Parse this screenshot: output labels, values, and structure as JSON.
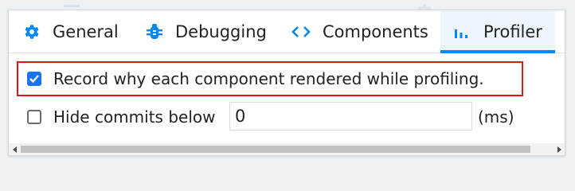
{
  "tabs": [
    {
      "label": "General",
      "icon": "gear-icon"
    },
    {
      "label": "Debugging",
      "icon": "bug-icon"
    },
    {
      "label": "Components",
      "icon": "code-brackets-icon"
    },
    {
      "label": "Profiler",
      "icon": "bar-chart-icon",
      "active": true
    }
  ],
  "settings": {
    "record_why_label": "Record why each component rendered while profiling.",
    "record_why_checked": true,
    "hide_commits_label": "Hide commits below",
    "hide_commits_checked": false,
    "hide_commits_value": "0",
    "hide_commits_unit": "(ms)"
  },
  "colors": {
    "accent": "#0088fa",
    "checkbox": "#1a73e8",
    "highlight_border": "#d41a1a",
    "active_tab_bg": "#edf5ff"
  }
}
